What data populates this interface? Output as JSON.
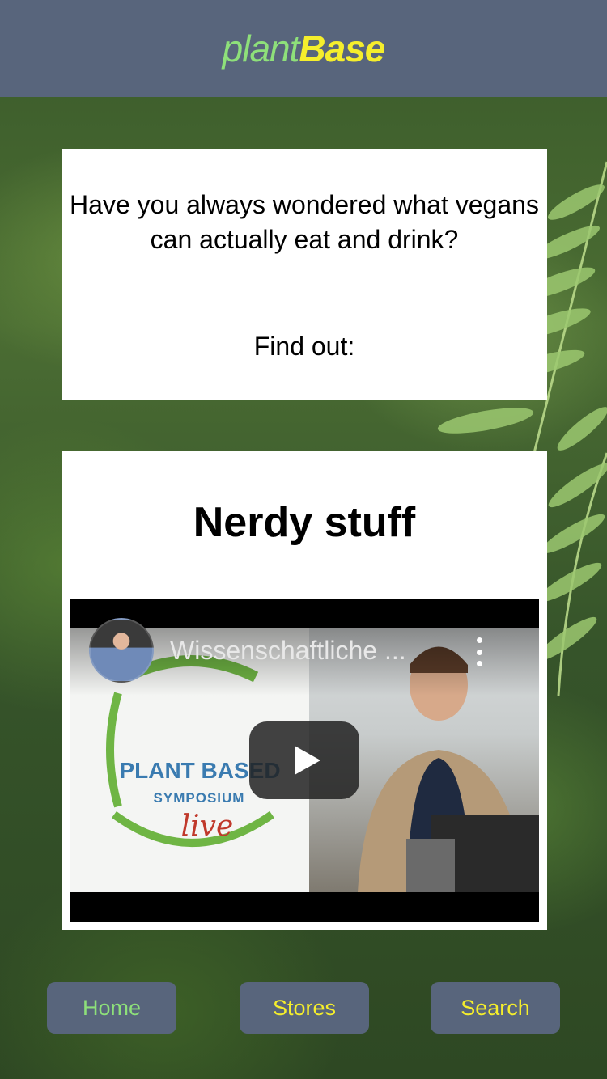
{
  "app": {
    "logo_part1": "plant",
    "logo_part2": "Base"
  },
  "intro_card": {
    "question": "Have you always wondered what vegans can actually eat and drink?",
    "find_out": "Find out:"
  },
  "video_card": {
    "title": "Nerdy stuff",
    "video": {
      "title": "Wissenschaftliche ...",
      "thumbnail_text_1": "PLANT BASED",
      "thumbnail_text_2": "SYMPOSIUM",
      "thumbnail_text_3": "live"
    }
  },
  "nav": {
    "home": "Home",
    "stores": "Stores",
    "search": "Search"
  },
  "colors": {
    "header_bg": "#58657c",
    "logo_plant": "#8ee07a",
    "logo_base": "#f5ee2c",
    "nav_home_text": "#8ee07a",
    "nav_other_text": "#f5ee2c"
  },
  "icons": [
    "play-icon",
    "more-vert-icon",
    "channel-avatar"
  ]
}
